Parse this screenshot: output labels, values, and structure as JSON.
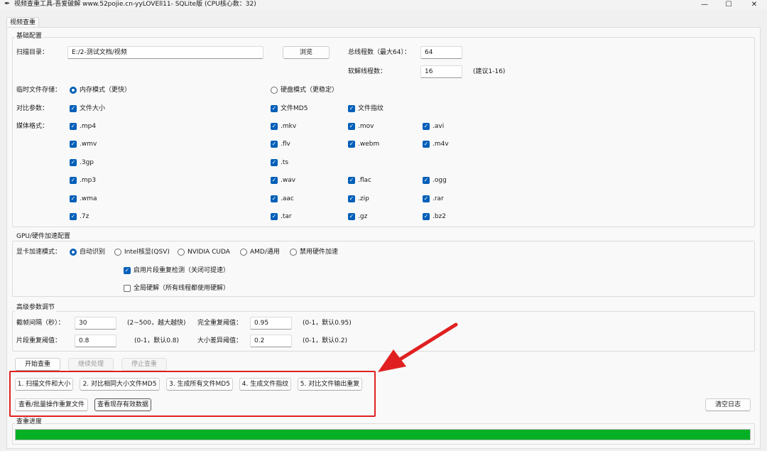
{
  "window": {
    "title": "视频查重工具-吾爱破解 www.52pojie.cn-yyLOVEll11- SQLite版 (CPU核心数：32)",
    "minimize_glyph": "—",
    "maximize_glyph": "☐",
    "close_glyph": "✕",
    "app_icon": "feather-icon"
  },
  "tabs": [
    {
      "label": "视频查重"
    }
  ],
  "basic": {
    "group_title": "基础配置",
    "scan_dir_label": "扫描目录：",
    "scan_dir_value": "E:/2-测试文档/视频",
    "browse_label": "浏览",
    "threads_label": "总线程数（最大64）：",
    "threads_value": "64",
    "decode_label": "软解线程数：",
    "decode_value": "16",
    "decode_hint": "(建议1-16)",
    "temp_label": "临时文件存储：",
    "temp_memory": "内存模式（更快）",
    "temp_disk": "硬盘模式（更稳定）",
    "compare_label": "对比参数：",
    "compare_size": "文件大小",
    "compare_md5": "文件MD5",
    "compare_fp": "文件指纹",
    "media_label": "媒体格式："
  },
  "formats": {
    "mp4": ".mp4",
    "mkv": ".mkv",
    "mov": ".mov",
    "avi": ".avi",
    "wmv": ".wmv",
    "flv": ".flv",
    "webm": ".webm",
    "m4v": ".m4v",
    "f3gp": ".3gp",
    "ts": ".ts",
    "mp3": ".mp3",
    "wav": ".wav",
    "flac": ".flac",
    "ogg": ".ogg",
    "wma": ".wma",
    "aac": ".aac",
    "zip": ".zip",
    "rar": ".rar",
    "f7z": ".7z",
    "tar": ".tar",
    "gz": ".gz",
    "bz2": ".bz2"
  },
  "gpu": {
    "group_title": "GPU/硬件加速配置",
    "mode_label": "显卡加速模式：",
    "auto": "自动识别",
    "intel": "Intel核显(QSV)",
    "nvidia": "NVIDIA CUDA",
    "amd": "AMD/通用",
    "disable": "禁用硬件加速",
    "segment_check": "启用片段重复检测（关闭可提速）",
    "global_hw": "全局硬解（所有线程都使用硬解）"
  },
  "advanced": {
    "group_title": "高级参数调节",
    "interval_label": "截帧间隔（秒）：",
    "interval_value": "30",
    "interval_hint": "(2~500，越大越快)",
    "full_label": "完全重复阈值：",
    "full_value": "0.95",
    "full_hint": "(0-1，默认0.95)",
    "seg_label": "片段重复阈值：",
    "seg_value": "0.8",
    "seg_hint": "(0-1，默认0.8)",
    "size_label": "大小差异阈值：",
    "size_value": "0.2",
    "size_hint": "(0-1，默认0.2)"
  },
  "actions": {
    "start": "开始查重",
    "continue": "继续处理",
    "stop": "停止查重",
    "step1": "1. 扫描文件和大小",
    "step2": "2. 对比相同大小文件MD5",
    "step3": "3. 生成所有文件MD5",
    "step4": "4. 生成文件指纹",
    "step5": "5. 对比文件输出重复",
    "view_batch": "查看/批量操作重复文件",
    "view_valid": "查看现存有效数据",
    "clear_log": "清空日志"
  },
  "progress": {
    "group_title": "查重进度",
    "value": 1.0,
    "color": "#06b025"
  },
  "annotation": {
    "color": "#e02020"
  }
}
